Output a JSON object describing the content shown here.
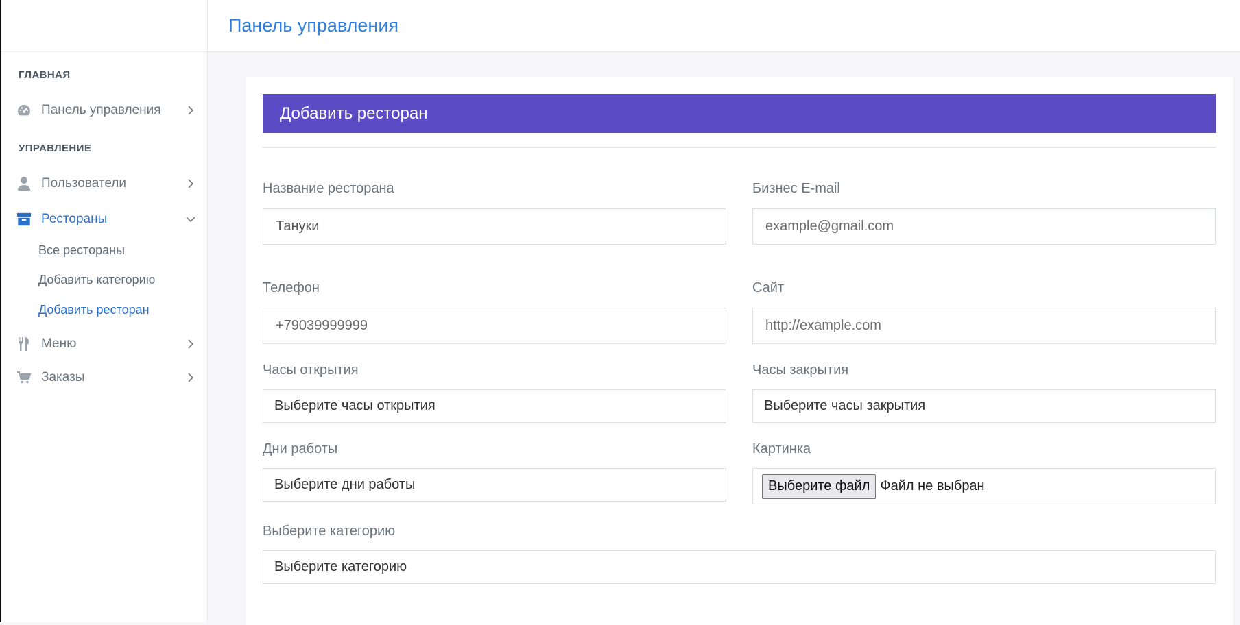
{
  "sidebar": {
    "sections": [
      {
        "label": "ГЛАВНАЯ"
      },
      {
        "label": "УПРАВЛЕНИЕ"
      }
    ],
    "items": [
      {
        "label": "Панель управления",
        "icon": "dashboard-icon"
      },
      {
        "label": "Пользователи",
        "icon": "user-icon"
      },
      {
        "label": "Рестораны",
        "icon": "archive-icon",
        "expanded": true
      },
      {
        "label": "Меню",
        "icon": "utensils-icon"
      },
      {
        "label": "Заказы",
        "icon": "cart-icon"
      }
    ],
    "subitems": [
      {
        "label": "Все рестораны"
      },
      {
        "label": "Добавить категорию"
      },
      {
        "label": "Добавить ресторан",
        "active": true
      }
    ]
  },
  "header": {
    "title": "Панель управления"
  },
  "form": {
    "title": "Добавить ресторан",
    "name": {
      "label": "Название ресторана",
      "value": "Тануки"
    },
    "email": {
      "label": "Бизнес E-mail",
      "placeholder": "example@gmail.com"
    },
    "phone": {
      "label": "Телефон",
      "placeholder": "+79039999999"
    },
    "site": {
      "label": "Сайт",
      "placeholder": "http://example.com"
    },
    "open_hours": {
      "label": "Часы открытия",
      "selected": "Выберите часы открытия"
    },
    "close_hours": {
      "label": "Часы закрытия",
      "selected": "Выберите часы закрытия"
    },
    "days": {
      "label": "Дни работы",
      "selected": "Выберите дни работы"
    },
    "image": {
      "label": "Картинка",
      "button": "Выберите файл",
      "status": "Файл не выбран"
    },
    "category": {
      "label": "Выберите категорию",
      "selected": "Выберите категорию"
    }
  },
  "colors": {
    "accent": "#5b4bc4",
    "link": "#2f7fe0",
    "active_nav": "#2a6fc9"
  }
}
